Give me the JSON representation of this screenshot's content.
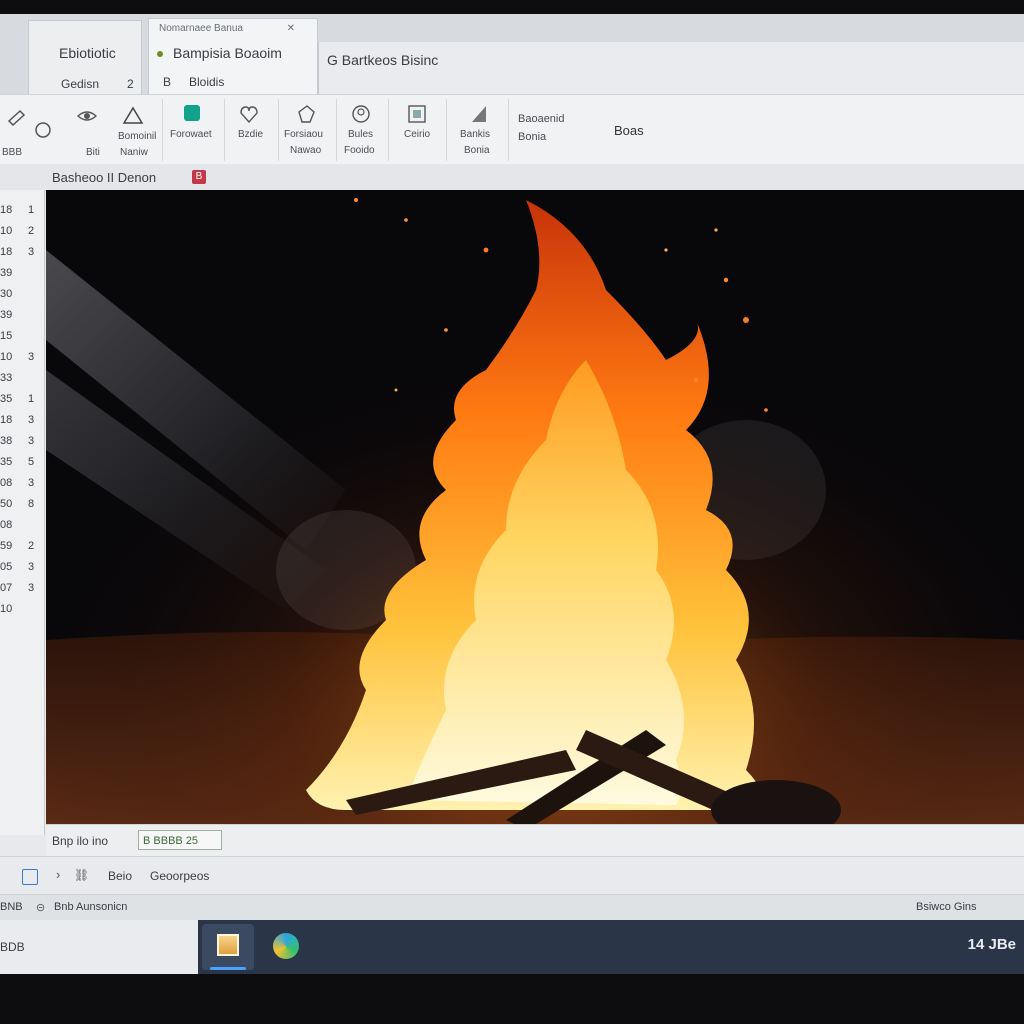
{
  "window": {
    "tab_left_title": "Ebiotiotic",
    "tab_left_sub": "Gedisn",
    "tab_left_num": "2",
    "tab_active_title": "Bampisia Boaoim",
    "tab_active_header": "Nomarnaee Banua",
    "tab_active_sub": "Bloidis",
    "tab_active_sub_mark": "B",
    "title_bar_text": "G Bartkeos Bisinc"
  },
  "ribbon": {
    "group1": {
      "top_label": "",
      "bottom_labels": [
        "BBB",
        "Biti",
        "Naniw"
      ]
    },
    "buttons": [
      {
        "label": "Bomoinil",
        "icon": "shape-triangle-icon"
      },
      {
        "label": "Forowaet",
        "icon": "teal-square-icon"
      },
      {
        "label": "Bzdie",
        "icon": "heart-shape-icon"
      },
      {
        "label": "Forsiaou",
        "label2": "Nawao",
        "icon": "gear-shape-icon"
      },
      {
        "label": "Bules",
        "label2": "Fooido",
        "icon": "circle-face-icon"
      },
      {
        "label": "Ceirio",
        "icon": "picture-frame-icon"
      },
      {
        "label": "Bankis",
        "label2": "Bonia",
        "icon": "triangle-fill-icon"
      },
      {
        "label": "Baoaenid",
        "label2": "Bonia",
        "icon": ""
      },
      {
        "label": "Boas",
        "icon": ""
      }
    ]
  },
  "subbar": {
    "title": "Basheoo II Denon",
    "badge": "B"
  },
  "gutter_rows": [
    {
      "a": "18",
      "b": "1"
    },
    {
      "a": "10",
      "b": "2"
    },
    {
      "a": "18",
      "b": "3"
    },
    {
      "a": "39",
      "b": ""
    },
    {
      "a": "30",
      "b": ""
    },
    {
      "a": "39",
      "b": ""
    },
    {
      "a": "15",
      "b": ""
    },
    {
      "a": "10",
      "b": "3"
    },
    {
      "a": "33",
      "b": ""
    },
    {
      "a": "35",
      "b": "1"
    },
    {
      "a": "18",
      "b": "3"
    },
    {
      "a": "38",
      "b": "3"
    },
    {
      "a": "35",
      "b": "5"
    },
    {
      "a": "08",
      "b": "3"
    },
    {
      "a": "50",
      "b": "8"
    },
    {
      "a": "08",
      "b": ""
    },
    {
      "a": "59",
      "b": "2"
    },
    {
      "a": "05",
      "b": "3"
    },
    {
      "a": "07",
      "b": "3"
    },
    {
      "a": "10",
      "b": ""
    }
  ],
  "viewer": {
    "alt": "campfire-photo"
  },
  "bottom": {
    "bar1_label": "Bnp ilo ino",
    "bar1_field": "B BBBB 25",
    "bar2_items": [
      "Beio",
      "Geoorpeos"
    ],
    "bar3_left": "Bnb Aunsonicn",
    "bar3_num": "BNB",
    "bar3_right": "Bsiwco Gins"
  },
  "taskbar": {
    "left_text": "BDB",
    "clock": "14 JBe",
    "accent": "#4aa3ff"
  }
}
